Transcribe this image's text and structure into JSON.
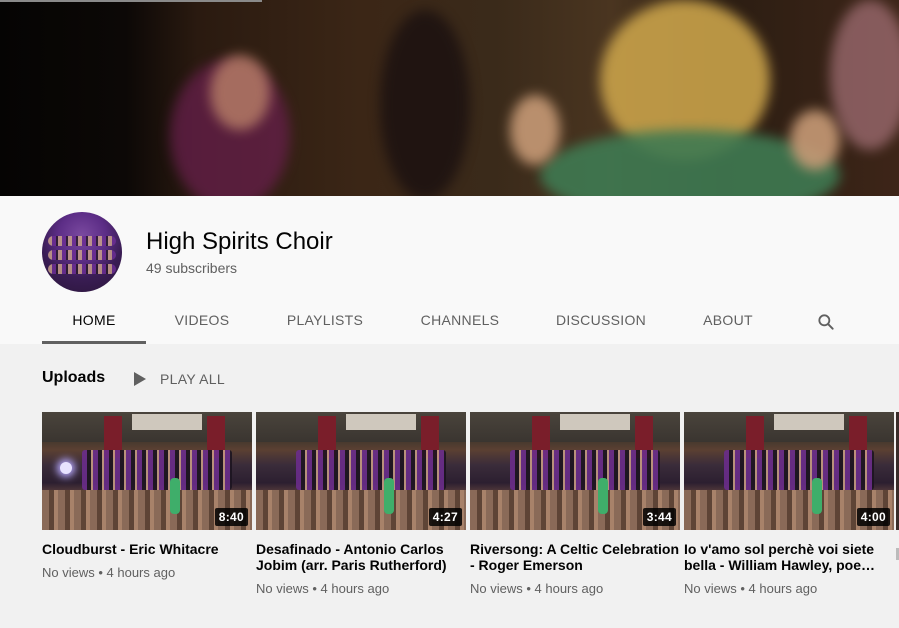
{
  "channel": {
    "name": "High Spirits Choir",
    "subscribers": "49 subscribers"
  },
  "tabs": [
    {
      "label": "HOME",
      "active": true
    },
    {
      "label": "VIDEOS",
      "active": false
    },
    {
      "label": "PLAYLISTS",
      "active": false
    },
    {
      "label": "CHANNELS",
      "active": false
    },
    {
      "label": "DISCUSSION",
      "active": false
    },
    {
      "label": "ABOUT",
      "active": false
    }
  ],
  "search_icon": "search-icon",
  "uploads": {
    "title": "Uploads",
    "play_all": "PLAY ALL",
    "videos": [
      {
        "title": "Cloudburst - Eric Whitacre",
        "duration": "8:40",
        "meta": "No views • 4 hours ago"
      },
      {
        "title": "Desafinado - Antonio Carlos Jobim (arr. Paris Rutherford)",
        "duration": "4:27",
        "meta": "No views • 4 hours ago"
      },
      {
        "title": "Riversong: A Celtic Celebration - Roger Emerson",
        "duration": "3:44",
        "meta": "No views • 4 hours ago"
      },
      {
        "title": "Io v'amo sol perchè voi siete bella - William Hawley, poe…",
        "duration": "4:00",
        "meta": "No views • 4 hours ago"
      }
    ]
  },
  "colors": {
    "page_bg": "#f1f1f1",
    "header_bg": "#f9f9f9",
    "text_primary": "#030303",
    "text_secondary": "#606060"
  }
}
